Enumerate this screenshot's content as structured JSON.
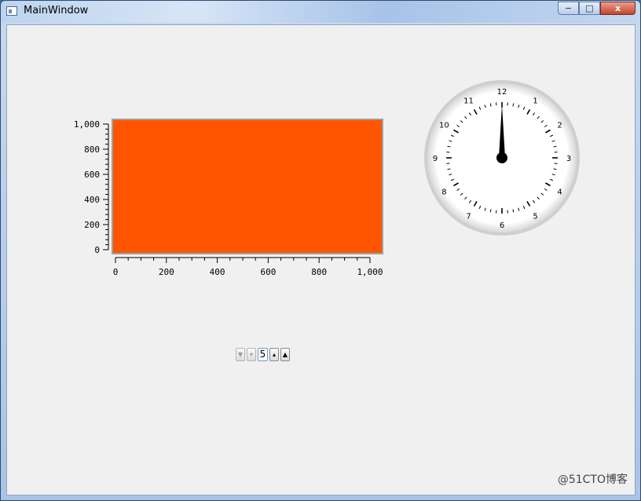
{
  "window": {
    "title": "MainWindow",
    "min_label": "−",
    "max_label": "□",
    "close_label": "x"
  },
  "chart_data": {
    "type": "area",
    "x": [
      0,
      1000
    ],
    "values": [
      1000,
      1000
    ],
    "xlim": [
      0,
      1000
    ],
    "ylim": [
      0,
      1000
    ],
    "xticks": [
      0,
      200,
      400,
      600,
      800,
      1000
    ],
    "yticks": [
      0,
      200,
      400,
      600,
      800,
      1000
    ],
    "xtick_labels": [
      "0",
      "200",
      "400",
      "600",
      "800",
      "1,000"
    ],
    "ytick_labels": [
      "0",
      "200",
      "400",
      "600",
      "800",
      "1,000"
    ],
    "fill_color": "#ff5500",
    "title": "",
    "xlabel": "",
    "ylabel": ""
  },
  "clock": {
    "numbers": [
      "12",
      "1",
      "2",
      "3",
      "4",
      "5",
      "6",
      "7",
      "8",
      "9",
      "10",
      "11"
    ],
    "hand_value": 0,
    "hand_color": "#000000"
  },
  "spinners": {
    "items": [
      {
        "name": "spin-down-double-button",
        "label": "▼",
        "state": "dim"
      },
      {
        "name": "spin-down-button",
        "label": "▾",
        "state": "dim"
      },
      {
        "name": "spin-value-field",
        "label": "5",
        "state": "edit"
      },
      {
        "name": "spin-up-button",
        "label": "▴",
        "state": "active"
      },
      {
        "name": "spin-up-double-button",
        "label": "▲",
        "state": "active"
      }
    ]
  },
  "watermark": "@51CTO博客"
}
